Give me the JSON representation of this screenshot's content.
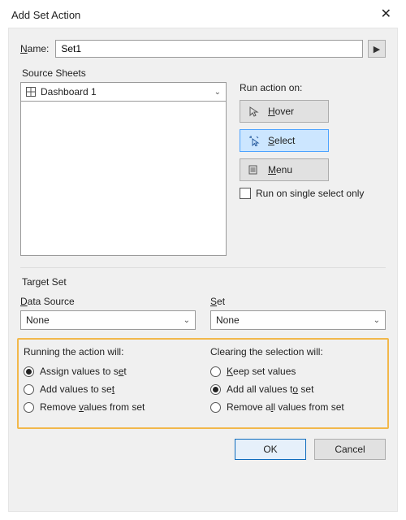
{
  "title": "Add Set Action",
  "name_label_pre": "N",
  "name_label_post": "ame:",
  "name_value": "Set1",
  "source_sheets_label": "Source Sheets",
  "source_sheet_selected": "Dashboard 1",
  "run_action_on_label": "Run action on:",
  "run_actions": {
    "hover_pre": "H",
    "hover_post": "over",
    "select_pre": "S",
    "select_post": "elect",
    "menu_pre": "M",
    "menu_post": "enu"
  },
  "run_single_select_label": "Run on single select only",
  "target_set_label": "Target Set",
  "data_source_pre": "D",
  "data_source_post": "ata Source",
  "data_source_value": "None",
  "set_pre": "S",
  "set_post": "et",
  "set_value": "None",
  "running_hdr": "Running the action will:",
  "running_opts": {
    "assign_pre": "Assign values to s",
    "assign_u": "e",
    "assign_post": "t",
    "add_pre": "Add values to se",
    "add_u": "t",
    "add_post": "",
    "remove_pre": "Remove ",
    "remove_u": "v",
    "remove_post": "alues from set"
  },
  "clearing_hdr": "Clearing the selection will:",
  "clearing_opts": {
    "keep_pre": "",
    "keep_u": "K",
    "keep_post": "eep set values",
    "addall_pre": "Add all values t",
    "addall_u": "o",
    "addall_post": " set",
    "removeall_pre": "Remove a",
    "removeall_u": "l",
    "removeall_post": "l values from set"
  },
  "ok_label": "OK",
  "cancel_label": "Cancel"
}
